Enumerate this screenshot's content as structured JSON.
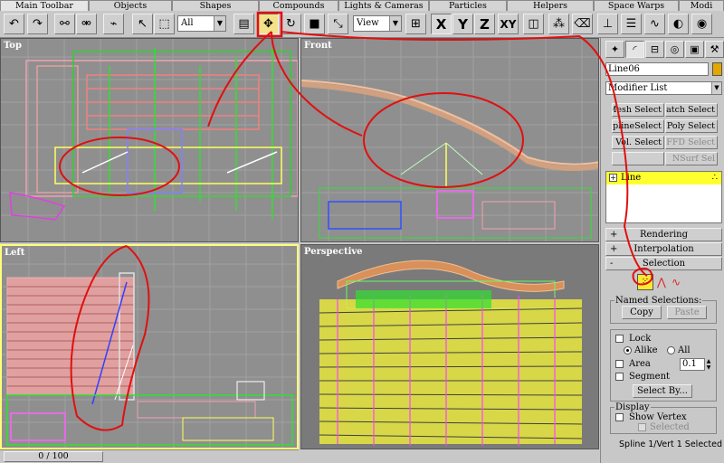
{
  "tabs": [
    {
      "label": "Main Toolbar",
      "active": true
    },
    {
      "label": "Objects"
    },
    {
      "label": "Shapes"
    },
    {
      "label": "Compounds"
    },
    {
      "label": "Lights & Cameras"
    },
    {
      "label": "Particles"
    },
    {
      "label": "Helpers"
    },
    {
      "label": "Space Warps"
    },
    {
      "label": "Modi"
    }
  ],
  "toolbar": {
    "selection_filter": "All",
    "reference_coord": "View",
    "axis_x": "X",
    "axis_y": "Y",
    "axis_z": "Z",
    "axis_xy": "XY"
  },
  "viewports": {
    "top": "Top",
    "front": "Front",
    "left": "Left",
    "perspective": "Perspective"
  },
  "timebar": {
    "frame": "0 / 100"
  },
  "panel": {
    "object_name": "Line06",
    "modifier_list": "Modifier List",
    "modifier_buttons": [
      "Mesh Select",
      "Patch Select",
      "SplineSelect",
      "Poly Select",
      "Vol. Select",
      "FFD Select",
      "",
      "NSurf Sel"
    ],
    "stack_item": "Line",
    "rollouts": {
      "rendering": "Rendering",
      "interpolation": "Interpolation",
      "selection": "Selection"
    },
    "named_selections": "Named Selections:",
    "copy": "Copy",
    "paste": "Paste",
    "lock": "Lock",
    "alike": "Alike",
    "all": "All",
    "area": "Area",
    "area_value": "0.1",
    "segment": "Segment",
    "select_by": "Select By...",
    "display": "Display",
    "show_vertex": "Show Vertex",
    "selected": "Selected",
    "status": "Spline 1/Vert 1 Selected"
  }
}
